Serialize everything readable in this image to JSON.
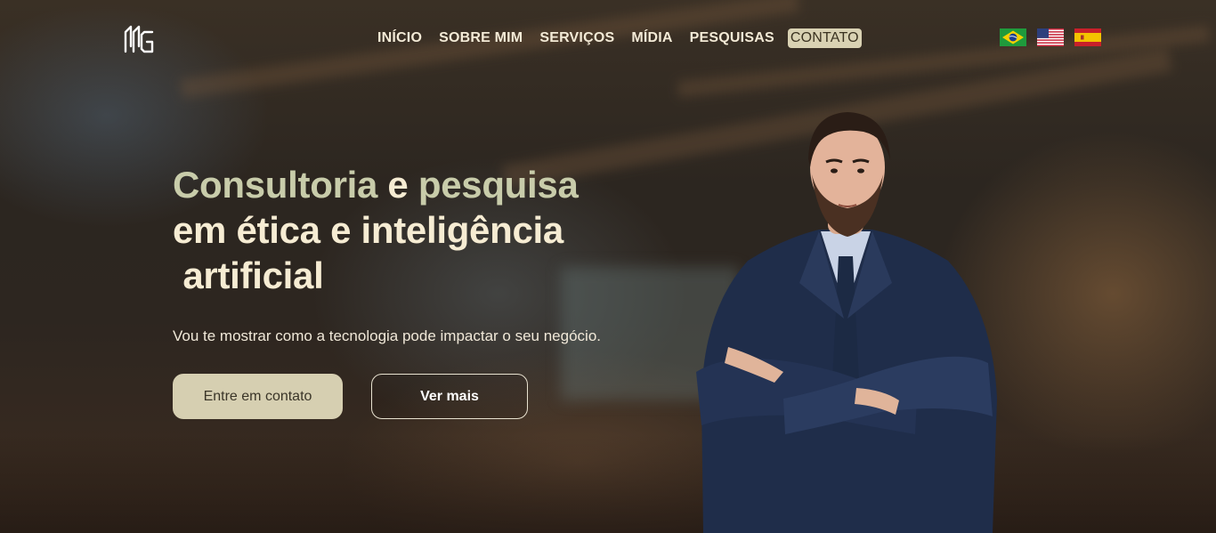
{
  "nav": {
    "items": [
      {
        "label": "INÍCIO"
      },
      {
        "label": "SOBRE MIM"
      },
      {
        "label": "SERVIÇOS"
      },
      {
        "label": "MÍDIA"
      },
      {
        "label": "PESQUISAS"
      },
      {
        "label": "CONTATO",
        "active": true
      }
    ]
  },
  "languages": [
    {
      "name": "brazil-flag-icon"
    },
    {
      "name": "usa-flag-icon"
    },
    {
      "name": "spain-flag-icon"
    }
  ],
  "hero": {
    "headline_line1_a": "Consultoria",
    "headline_line1_b": " e ",
    "headline_line1_c": "pesquisa",
    "headline_line2": "em ética e inteligência",
    "headline_line3": " artificial",
    "subtitle": "Vou te mostrar como a tecnologia pode impactar o seu negócio.",
    "primary_button": "Entre em contato",
    "secondary_button": "Ver mais"
  },
  "colors": {
    "accent": "#c8ccaa",
    "cream": "#f6ecd3",
    "button_bg": "#d6cfb1"
  }
}
